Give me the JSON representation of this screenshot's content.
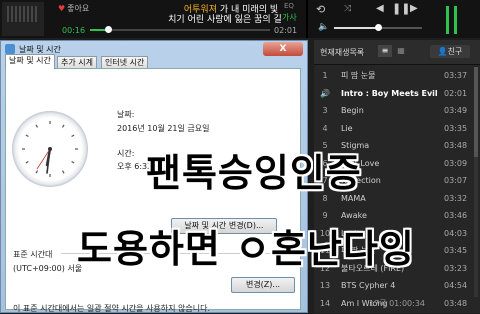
{
  "player": {
    "likes": "좋아요",
    "title_artist": "어투워져",
    "title_rest": " 가 내 미래의 빛",
    "subtitle": "치기 어린 사랑에 잃은 꿈의 길",
    "eq_label": "EQ",
    "lyrics_label": "가사",
    "time_current": "00:16",
    "time_total": "02:01",
    "progress": 0.1,
    "volume": 0.5,
    "accent_color": "#2ec24e"
  },
  "playlist": {
    "tab_now_playing": "현재재생목록",
    "friends_button": "친구",
    "tracks": [
      {
        "num": "1",
        "name": "피 땀 눈물",
        "duration": "03:37"
      },
      {
        "num": "",
        "name": "Intro : Boy Meets Evil",
        "duration": "02:01",
        "playing": true
      },
      {
        "num": "3",
        "name": "Begin",
        "duration": "03:49"
      },
      {
        "num": "4",
        "name": "Lie",
        "duration": "03:35"
      },
      {
        "num": "5",
        "name": "Stigma",
        "duration": "03:48"
      },
      {
        "num": "6",
        "name": "First Love",
        "duration": "03:09"
      },
      {
        "num": "7",
        "name": "Reflection",
        "duration": "03:07"
      },
      {
        "num": "8",
        "name": "MAMA",
        "duration": "03:32"
      },
      {
        "num": "9",
        "name": "Awake",
        "duration": "03:46"
      },
      {
        "num": "10",
        "name": "Lost",
        "duration": "04:03"
      },
      {
        "num": "11",
        "name": "피 땀 눈물",
        "duration": "03:45"
      },
      {
        "num": "12",
        "name": "불타오르네 (FIRE)",
        "duration": "03:23"
      },
      {
        "num": "13",
        "name": "BTS Cypher 4",
        "duration": "04:54"
      },
      {
        "num": "14",
        "name": "Am I Wrong",
        "duration": "03:48"
      }
    ],
    "status": "17곡 01:00:34"
  },
  "dialog": {
    "title": "날짜 및 시간",
    "close_label": "X",
    "tabs": [
      "날짜 및 시간",
      "추가 시계",
      "인터넷 시간"
    ],
    "date_label": "날짜:",
    "date_value": "2016년 10월 21일 금요일",
    "time_label": "시간:",
    "time_value": "오후 6:32:",
    "change_datetime_button": "날짜 및 시간 변경(D)...",
    "timezone_header": "표준 시간대",
    "timezone_value": "(UTC+09:00) 서울",
    "change_timezone_button": "변경(Z)...",
    "dst_note": "이 표준 시간대에서는 일광 절약 시간을 사용하지 않습니다."
  },
  "overlay": {
    "line1": "팬톡승잉인증",
    "line2": "도용하면 ㅇ혼난다잉"
  },
  "icons": [
    "repeat-icon",
    "shuffle-icon",
    "prev-icon",
    "pause-icon",
    "next-icon",
    "volume-icon",
    "heart-icon",
    "list-icon",
    "grid-icon",
    "clock-icon",
    "speaker-icon"
  ]
}
